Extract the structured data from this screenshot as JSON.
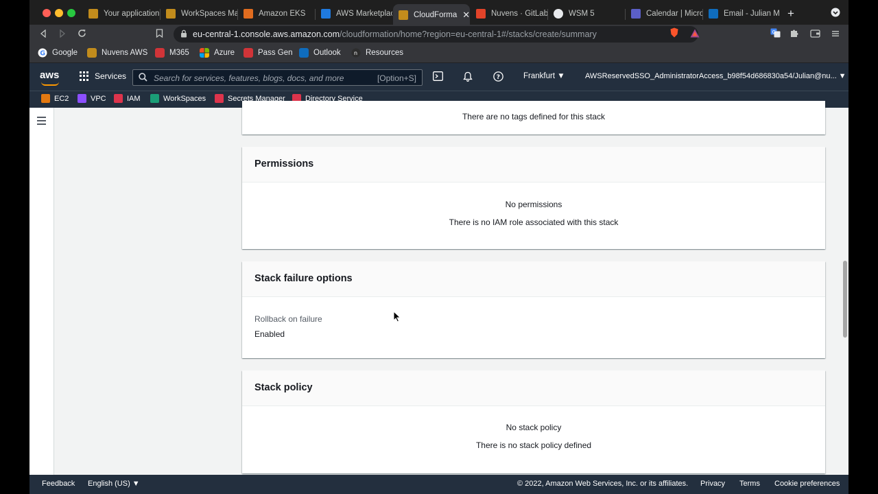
{
  "browser": {
    "tabs": [
      {
        "label": "Your application",
        "color": "#c28c1c"
      },
      {
        "label": "WorkSpaces Ma",
        "color": "#c28c1c"
      },
      {
        "label": "Amazon EKS",
        "color": "#e06c1f"
      },
      {
        "label": "AWS Marketplac",
        "color": "#1f7ae0"
      },
      {
        "label": "CloudForma",
        "color": "#c28c1c"
      },
      {
        "label": "Nuvens · GitLab",
        "color": "#e24329"
      },
      {
        "label": "WSM 5",
        "color": "#e8eaed"
      },
      {
        "label": "Calendar | Micro",
        "color": "#5b5fc7"
      },
      {
        "label": "Email - Julian M",
        "color": "#0f6cbd"
      }
    ],
    "address": {
      "host": "eu-central-1.console.aws.amazon.com",
      "path": "/cloudformation/home?region=eu-central-1#/stacks/create/summary"
    },
    "bookmarks": [
      {
        "label": "Google",
        "color": "#ffffff"
      },
      {
        "label": "Nuvens AWS",
        "color": "#c28c1c"
      },
      {
        "label": "M365",
        "color": "#d13438"
      },
      {
        "label": "Azure",
        "color": "#0f9d58"
      },
      {
        "label": "Pass Gen",
        "color": "#d13438"
      },
      {
        "label": "Outlook",
        "color": "#0f6cbd"
      },
      {
        "label": "Resources",
        "color": "#2d2d2d"
      }
    ]
  },
  "aws_nav": {
    "logo": "aws",
    "services_label": "Services",
    "search_placeholder": "Search for services, features, blogs, docs, and more",
    "search_shortcut": "[Option+S]",
    "region": "Frankfurt ▼",
    "account": "AWSReservedSSO_AdministratorAccess_b98f54d686830a54/Julian@nu... ▼"
  },
  "favorites": [
    {
      "label": "EC2",
      "color": "#e47911"
    },
    {
      "label": "VPC",
      "color": "#8c4fff"
    },
    {
      "label": "IAM",
      "color": "#dd344c"
    },
    {
      "label": "WorkSpaces",
      "color": "#1b9e77"
    },
    {
      "label": "Secrets Manager",
      "color": "#dd344c"
    },
    {
      "label": "Directory Service",
      "color": "#dd344c"
    }
  ],
  "content": {
    "tags_message": "There are no tags defined for this stack",
    "permissions": {
      "title": "Permissions",
      "empty_title": "No permissions",
      "empty_text": "There is no IAM role associated with this stack"
    },
    "failure_options": {
      "title": "Stack failure options",
      "label": "Rollback on failure",
      "value": "Enabled"
    },
    "stack_policy": {
      "title": "Stack policy",
      "empty_title": "No stack policy",
      "empty_text": "There is no stack policy defined"
    }
  },
  "footer": {
    "feedback": "Feedback",
    "language": "English (US) ▼",
    "copyright": "© 2022, Amazon Web Services, Inc. or its affiliates.",
    "privacy": "Privacy",
    "terms": "Terms",
    "cookies": "Cookie preferences"
  }
}
